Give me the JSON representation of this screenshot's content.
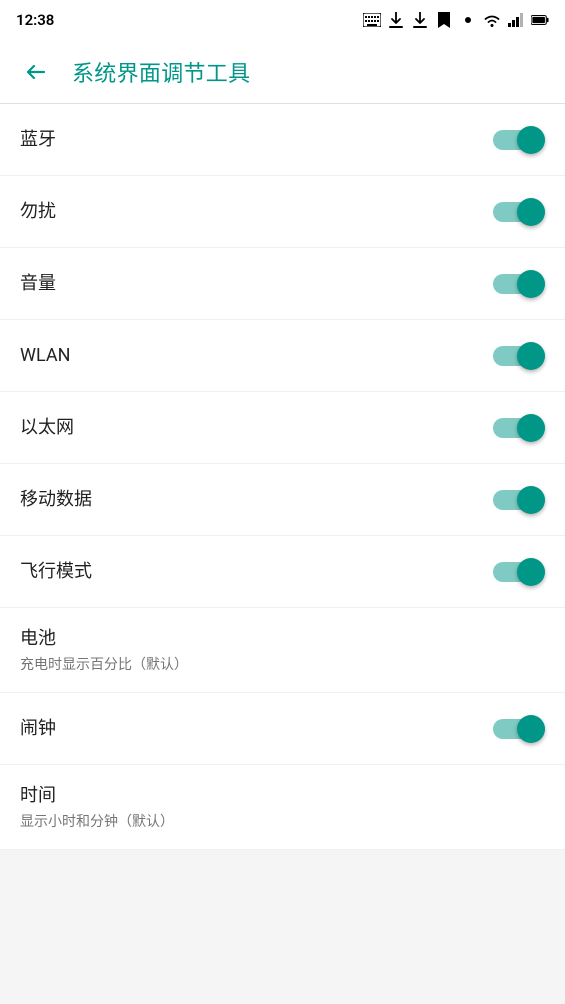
{
  "statusBar": {
    "time": "12:38"
  },
  "appBar": {
    "title": "系统界面调节工具",
    "backLabel": "返回"
  },
  "settings": [
    {
      "id": "bluetooth",
      "title": "蓝牙",
      "subtitle": "",
      "toggled": true,
      "hasToggle": true
    },
    {
      "id": "do-not-disturb",
      "title": "勿扰",
      "subtitle": "",
      "toggled": true,
      "hasToggle": true
    },
    {
      "id": "volume",
      "title": "音量",
      "subtitle": "",
      "toggled": true,
      "hasToggle": true
    },
    {
      "id": "wlan",
      "title": "WLAN",
      "subtitle": "",
      "toggled": true,
      "hasToggle": true
    },
    {
      "id": "ethernet",
      "title": "以太网",
      "subtitle": "",
      "toggled": true,
      "hasToggle": true
    },
    {
      "id": "mobile-data",
      "title": "移动数据",
      "subtitle": "",
      "toggled": true,
      "hasToggle": true
    },
    {
      "id": "airplane-mode",
      "title": "飞行模式",
      "subtitle": "",
      "toggled": true,
      "hasToggle": true
    },
    {
      "id": "battery",
      "title": "电池",
      "subtitle": "充电时显示百分比（默认）",
      "toggled": false,
      "hasToggle": false
    },
    {
      "id": "alarm",
      "title": "闹钟",
      "subtitle": "",
      "toggled": true,
      "hasToggle": true
    },
    {
      "id": "time",
      "title": "时间",
      "subtitle": "显示小时和分钟（默认）",
      "toggled": false,
      "hasToggle": false
    }
  ]
}
